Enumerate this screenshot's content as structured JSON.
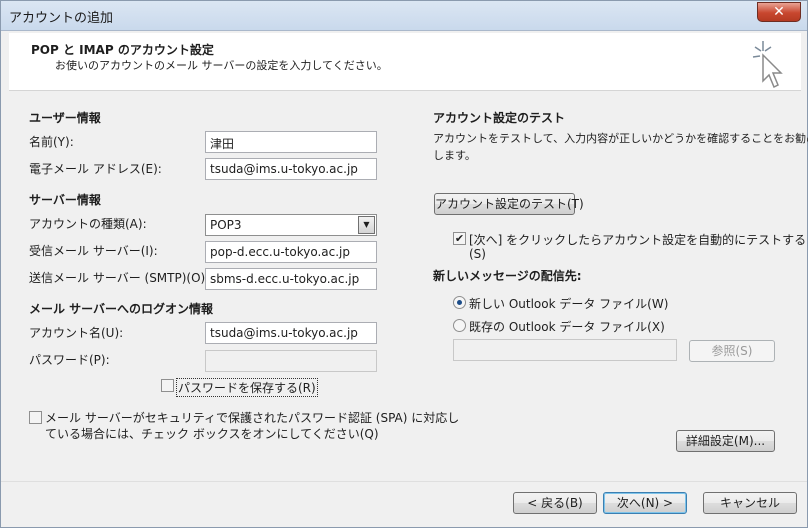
{
  "window": {
    "title": "アカウントの追加",
    "close_glyph": "✕"
  },
  "header": {
    "title": "POP と IMAP のアカウント設定",
    "subtitle": "お使いのアカウントのメール サーバーの設定を入力してください。",
    "icon": "cursor-sparkle-icon"
  },
  "user_info": {
    "heading": "ユーザー情報",
    "name_label": "名前(Y):",
    "name_value": "津田",
    "email_label": "電子メール アドレス(E):",
    "email_value": "tsuda@ims.u-tokyo.ac.jp"
  },
  "server_info": {
    "heading": "サーバー情報",
    "account_type_label": "アカウントの種類(A):",
    "account_type_value": "POP3",
    "incoming_label": "受信メール サーバー(I):",
    "incoming_value": "pop-d.ecc.u-tokyo.ac.jp",
    "outgoing_label": "送信メール サーバー (SMTP)(O):",
    "outgoing_value": "sbms-d.ecc.u-tokyo.ac.jp"
  },
  "logon_info": {
    "heading": "メール サーバーへのログオン情報",
    "account_name_label": "アカウント名(U):",
    "account_name_value": "tsuda@ims.u-tokyo.ac.jp",
    "password_label": "パスワード(P):",
    "password_value": "",
    "remember_password_label": "パスワードを保存する(R)",
    "remember_password_checked": false,
    "spa_label_line1": "メール サーバーがセキュリティで保護されたパスワード認証 (SPA) に対応し",
    "spa_label_line2": "ている場合には、チェック ボックスをオンにしてください(Q)",
    "spa_checked": false
  },
  "test": {
    "heading": "アカウント設定のテスト",
    "description_line1": "アカウントをテストして、入力内容が正しいかどうかを確認することをお勧め",
    "description_line2": "します。",
    "test_button": "アカウント設定のテスト(T)",
    "auto_test_label_line1": "[次へ] をクリックしたらアカウント設定を自動的にテストする",
    "auto_test_label_line2": "(S)",
    "auto_test_checked": true,
    "check_glyph": "✔"
  },
  "delivery": {
    "heading": "新しいメッセージの配信先:",
    "option_new": "新しい Outlook データ ファイル(W)",
    "option_existing": "既存の Outlook データ ファイル(X)",
    "selected": "new",
    "existing_path": "",
    "browse_button": "参照(S)"
  },
  "more_settings_button": "詳細設定(M)...",
  "footer": {
    "back_button": "< 戻る(B)",
    "next_button": "次へ(N) >",
    "cancel_button": "キャンセル"
  }
}
